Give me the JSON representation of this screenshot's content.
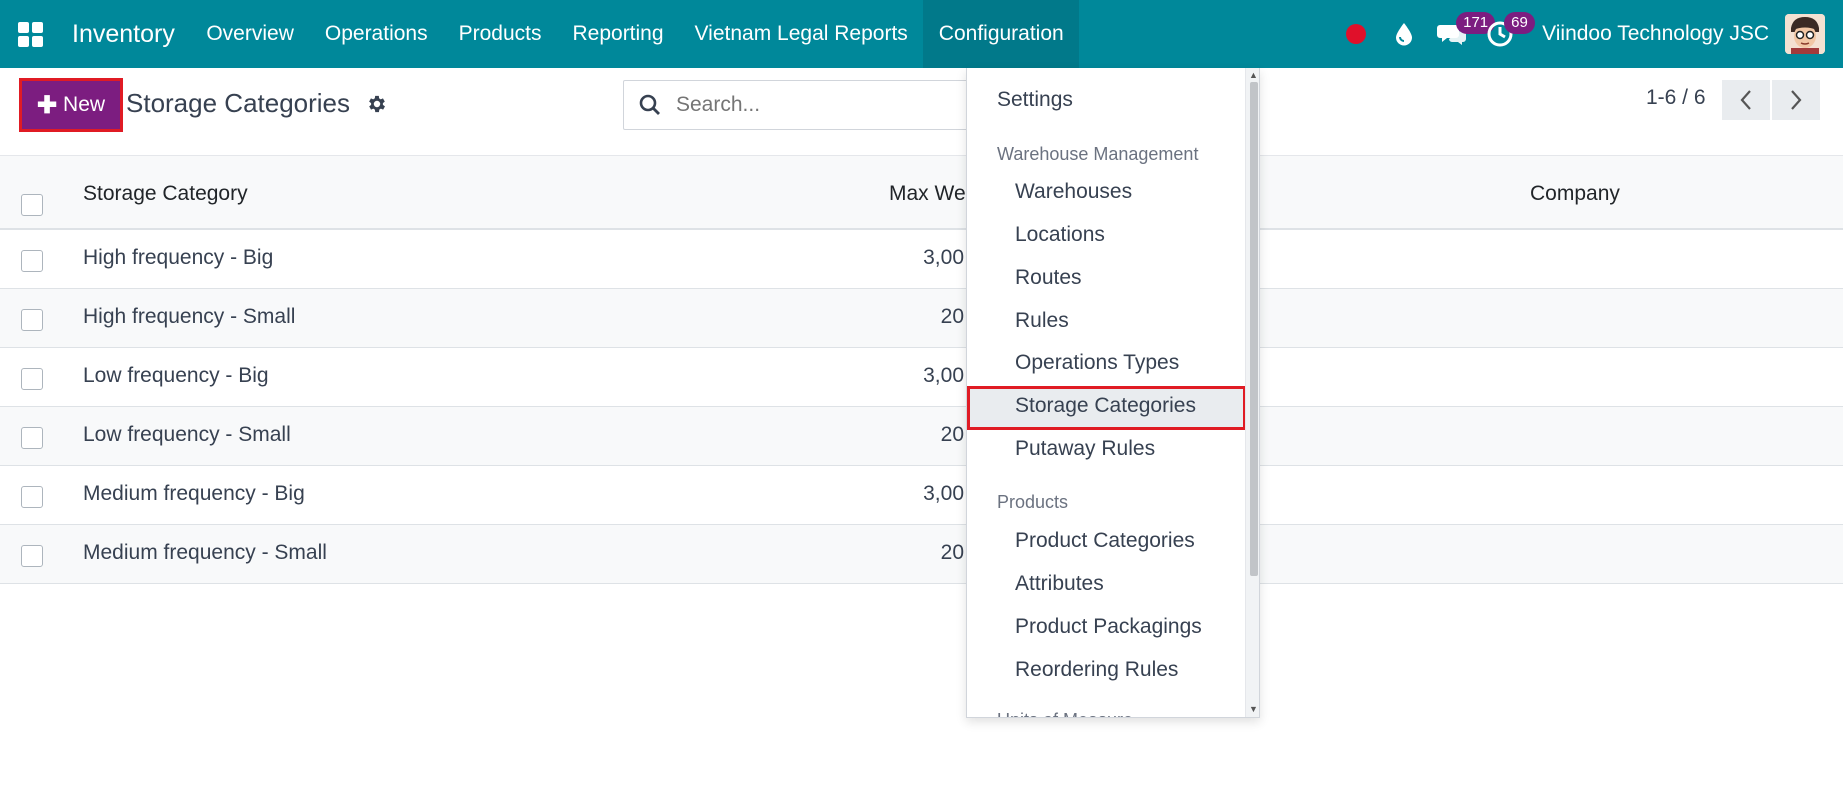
{
  "navbar": {
    "brand": "Inventory",
    "items": [
      "Overview",
      "Operations",
      "Products",
      "Reporting",
      "Vietnam Legal Reports",
      "Configuration"
    ],
    "active_item": "Configuration",
    "messages_badge": "171",
    "activities_badge": "69",
    "company": "Viindoo Technology JSC",
    "accent_color": "#00889a"
  },
  "control": {
    "new_label": "New",
    "title": "Storage Categories",
    "search_placeholder": "Search...",
    "pager_text": "1-6 / 6"
  },
  "list": {
    "columns": [
      "Storage Category",
      "Max We",
      "Company"
    ],
    "rows": [
      {
        "name": "High frequency - Big",
        "weight": "3,00"
      },
      {
        "name": "High frequency - Small",
        "weight": "20"
      },
      {
        "name": "Low frequency - Big",
        "weight": "3,00"
      },
      {
        "name": "Low frequency - Small",
        "weight": "20"
      },
      {
        "name": "Medium frequency - Big",
        "weight": "3,00"
      },
      {
        "name": "Medium frequency - Small",
        "weight": "20"
      }
    ]
  },
  "dropdown": {
    "settings": "Settings",
    "section_warehouse": "Warehouse Management",
    "warehouse_items": [
      "Warehouses",
      "Locations",
      "Routes",
      "Rules",
      "Operations Types",
      "Storage Categories",
      "Putaway Rules"
    ],
    "section_products": "Products",
    "product_items": [
      "Product Categories",
      "Attributes",
      "Product Packagings",
      "Reordering Rules"
    ],
    "section_uom": "Units of Measure",
    "selected": "Storage Categories"
  }
}
